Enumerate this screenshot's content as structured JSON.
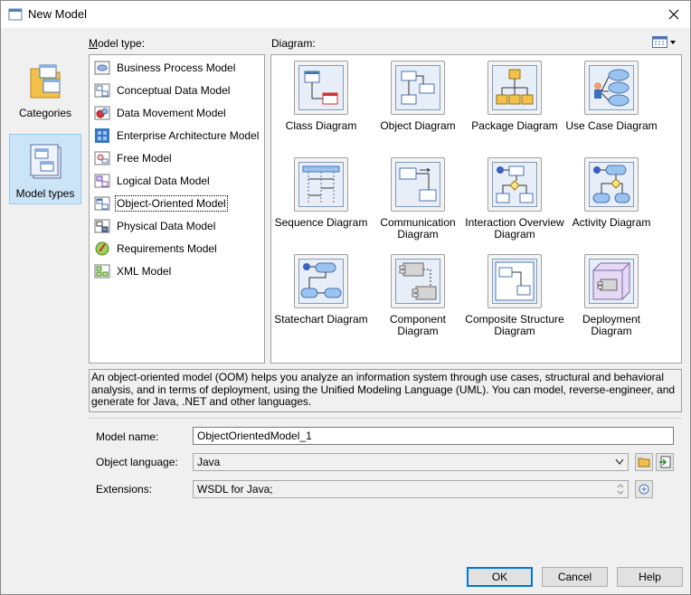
{
  "window": {
    "title": "New Model"
  },
  "categories": [
    {
      "label": "Categories"
    },
    {
      "label": "Model types"
    }
  ],
  "model_type_label": "Model type:",
  "diagram_label": "Diagram:",
  "model_types": [
    {
      "label": "Business Process Model",
      "icon": "business-process-icon"
    },
    {
      "label": "Conceptual Data Model",
      "icon": "conceptual-data-icon"
    },
    {
      "label": "Data Movement Model",
      "icon": "data-movement-icon"
    },
    {
      "label": "Enterprise Architecture Model",
      "icon": "enterprise-architecture-icon"
    },
    {
      "label": "Free Model",
      "icon": "free-model-icon"
    },
    {
      "label": "Logical Data Model",
      "icon": "logical-data-icon"
    },
    {
      "label": "Object-Oriented Model",
      "icon": "object-oriented-icon",
      "selected": true
    },
    {
      "label": "Physical Data Model",
      "icon": "physical-data-icon"
    },
    {
      "label": "Requirements Model",
      "icon": "requirements-icon"
    },
    {
      "label": "XML Model",
      "icon": "xml-model-icon"
    }
  ],
  "diagrams": [
    {
      "label": "Class Diagram"
    },
    {
      "label": "Object Diagram"
    },
    {
      "label": "Package Diagram"
    },
    {
      "label": "Use Case Diagram"
    },
    {
      "label": "Sequence Diagram"
    },
    {
      "label": "Communication Diagram"
    },
    {
      "label": "Interaction Overview Diagram"
    },
    {
      "label": "Activity Diagram"
    },
    {
      "label": "Statechart Diagram"
    },
    {
      "label": "Component Diagram"
    },
    {
      "label": "Composite Structure Diagram"
    },
    {
      "label": "Deployment Diagram"
    }
  ],
  "description": "An object-oriented model (OOM) helps you analyze an information system through use cases, structural and behavioral analysis, and in terms of deployment, using the Unified Modeling Language (UML). You can model, reverse-engineer, and generate for Java, .NET and other languages.",
  "form": {
    "model_name_label": "Model name:",
    "model_name_value": "ObjectOrientedModel_1",
    "object_language_label": "Object language:",
    "object_language_value": "Java",
    "extensions_label": "Extensions:",
    "extensions_value": "WSDL for Java;"
  },
  "buttons": {
    "ok": "OK",
    "cancel": "Cancel",
    "help": "Help"
  },
  "colors": {
    "selection": "#cce4f7",
    "focus": "#0078d7"
  }
}
